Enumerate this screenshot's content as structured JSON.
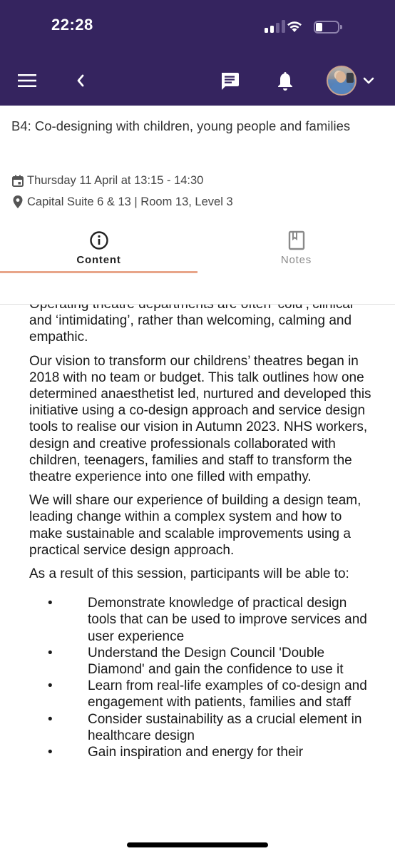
{
  "status_bar": {
    "time": "22:28",
    "signal_bars_active": 2,
    "signal_bars_total": 4,
    "battery_level": 0.2
  },
  "header": {
    "menu_icon": "hamburger-menu-icon",
    "back_icon": "chevron-left-icon",
    "chat_icon": "chat-message-icon",
    "notification_icon": "bell-icon",
    "profile_dropdown_icon": "chevron-down-icon",
    "background_color": "#35245f"
  },
  "session": {
    "title": "B4: Co-designing with children, young people and families",
    "date_time": "Thursday 11 April at 13:15 - 14:30",
    "location": "Capital Suite 6 & 13 | Room 13, Level 3"
  },
  "tabs": [
    {
      "label": "Content",
      "icon": "info-circle-icon",
      "active": true
    },
    {
      "label": "Notes",
      "icon": "bookmark-book-icon",
      "active": false
    }
  ],
  "accent_color": "#e8a589",
  "content": {
    "paragraphs": [
      "Operating theatre departments are often ‘cold’,‘clinical’ and ‘intimidating’, rather than welcoming, calming and empathic.",
      "Our vision to transform our childrens’ theatres began in 2018 with no team or budget.  This talk outlines how one determined anaesthetist led, nurtured and developed this initiative using a co-design approach and service design tools to realise our vision in Autumn 2023.  NHS workers, design and creative professionals collaborated with children, teenagers, families and staff to transform the theatre experience into one filled with empathy.",
      "We will share our experience of building a design team, leading change within a complex system and how to make sustainable and scalable improvements using a practical service design approach.",
      "As a result of this session, participants will be able to:"
    ],
    "bullets": [
      "Demonstrate knowledge of practical design tools that can be used to improve services and user experience",
      "Understand the Design Council 'Double Diamond' and gain the confidence to use it",
      "Learn from real-life examples of co-design and engagement with patients, families and staff",
      "Consider sustainability as a crucial element in healthcare design",
      "Gain inspiration and energy for their"
    ]
  }
}
